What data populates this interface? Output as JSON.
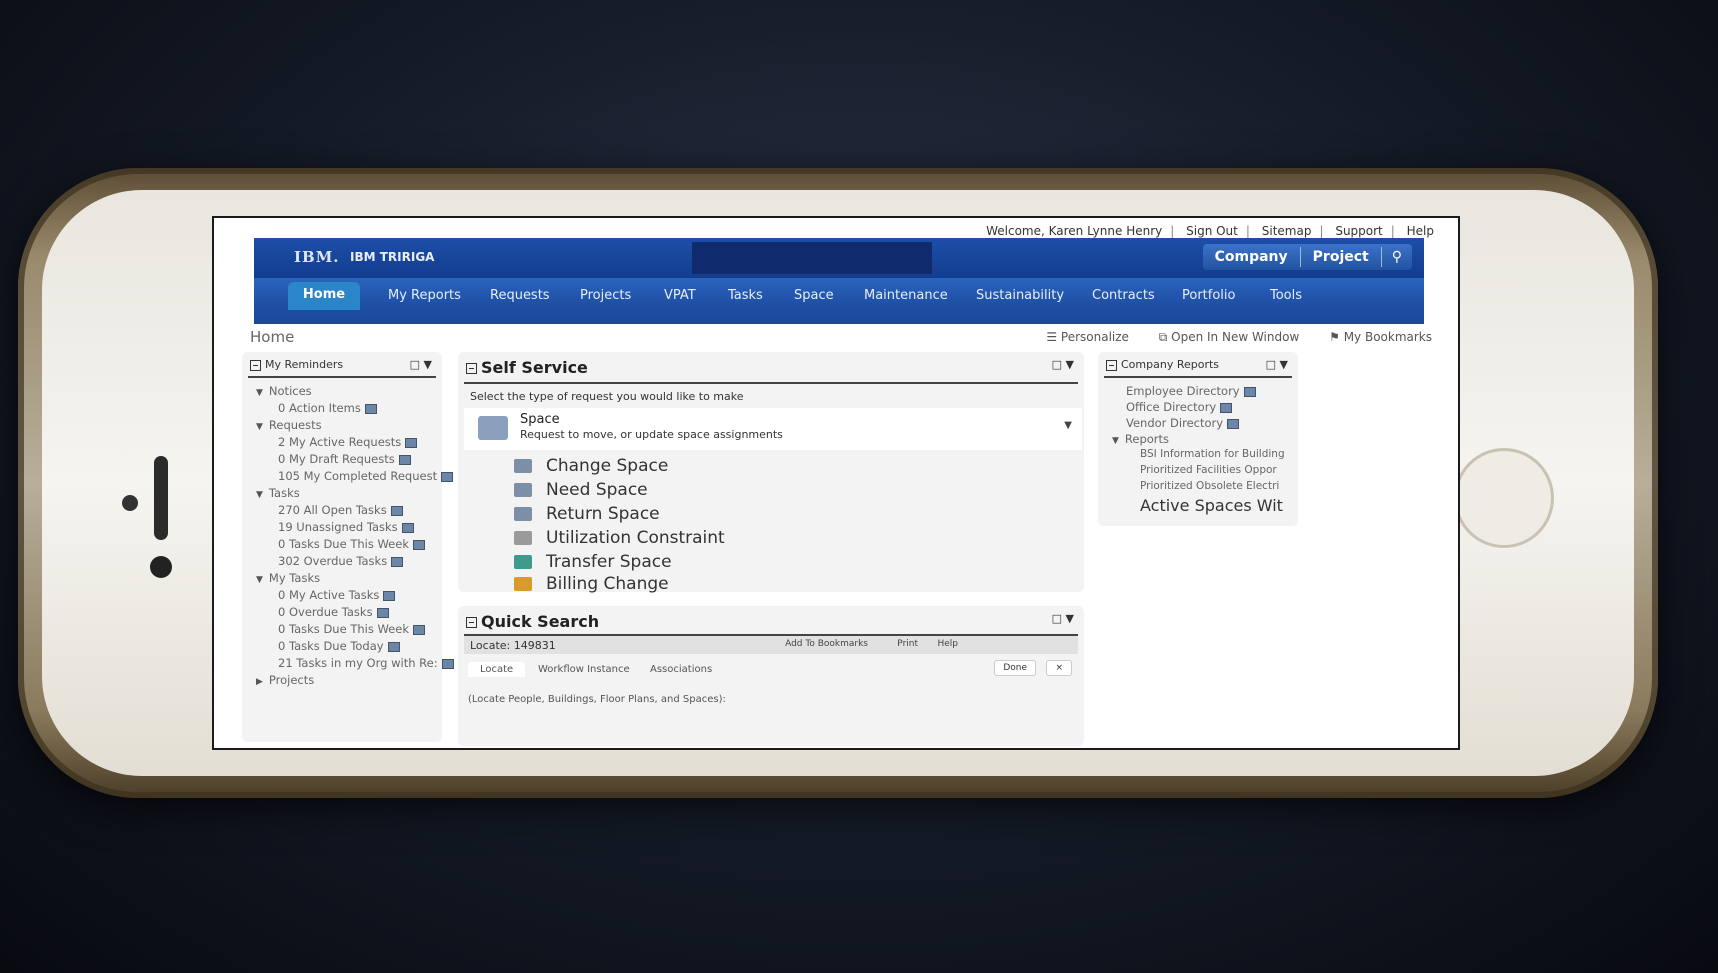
{
  "colors": {
    "header_blue": "#1d4ea8",
    "nav_blue": "#1e4fa4",
    "home_tab": "#2a86c9",
    "panel_bg": "#f3f3f3"
  },
  "top_links": {
    "welcome": "Welcome, Karen Lynne Henry",
    "sign_out": "Sign Out",
    "sitemap": "Sitemap",
    "support": "Support",
    "help": "Help"
  },
  "header": {
    "logo": "IBM.",
    "product": "IBM TRIRIGA",
    "company": "Company",
    "project": "Project",
    "search_icon": "search-icon"
  },
  "nav": {
    "items": [
      "Home",
      "My Reports",
      "Requests",
      "Projects",
      "VPAT",
      "Tasks",
      "Space",
      "Maintenance",
      "Sustainability",
      "Contracts",
      "Portfolio",
      "Tools"
    ]
  },
  "breadcrumb": "Home",
  "toolbar": {
    "personalize": "Personalize",
    "open_new_window": "Open In New Window",
    "bookmarks": "My Bookmarks"
  },
  "reminders": {
    "title": "My Reminders",
    "tree": [
      {
        "label": "Notices",
        "level": 0
      },
      {
        "label": "0 Action Items",
        "level": 1
      },
      {
        "label": "Requests",
        "level": 0
      },
      {
        "label": "2 My Active Requests",
        "level": 1
      },
      {
        "label": "0 My Draft Requests",
        "level": 1
      },
      {
        "label": "105 My Completed Request",
        "level": 1
      },
      {
        "label": "Tasks",
        "level": 0
      },
      {
        "label": "270 All Open Tasks",
        "level": 1
      },
      {
        "label": "19 Unassigned Tasks",
        "level": 1
      },
      {
        "label": "0 Tasks Due This Week",
        "level": 1
      },
      {
        "label": "302 Overdue Tasks",
        "level": 1
      },
      {
        "label": "My Tasks",
        "level": 0
      },
      {
        "label": "0 My Active Tasks",
        "level": 1
      },
      {
        "label": "0 Overdue Tasks",
        "level": 1
      },
      {
        "label": "0 Tasks Due This Week",
        "level": 1
      },
      {
        "label": "0 Tasks Due Today",
        "level": 1
      },
      {
        "label": "21 Tasks in my Org with Re:",
        "level": 1
      },
      {
        "label": "Projects",
        "level": 0
      }
    ]
  },
  "self_service": {
    "title": "Self Service",
    "prompt": "Select the type of request you would like to make",
    "category": "Space",
    "category_desc": "Request to move, or update space assignments",
    "items": [
      "Change Space",
      "Need Space",
      "Return Space",
      "Utilization Constraint",
      "Transfer Space",
      "Billing Change"
    ]
  },
  "quick_search": {
    "title": "Quick Search",
    "locate": "Locate: 149831",
    "add_bookmarks": "Add To Bookmarks",
    "print": "Print",
    "help": "Help",
    "tabs": [
      "Locate",
      "Workflow Instance",
      "Associations"
    ],
    "done": "Done",
    "close": "×",
    "hint": "(Locate People, Buildings, Floor Plans, and Spaces):"
  },
  "company_reports": {
    "title": "Company Reports",
    "items": [
      "Employee Directory",
      "Office Directory",
      "Vendor Directory"
    ],
    "reports_label": "Reports",
    "reports": [
      "BSI Information for Building",
      "Prioritized Facilities Oppor",
      "Prioritized Obsolete Electri",
      "Active Spaces Wit"
    ]
  }
}
